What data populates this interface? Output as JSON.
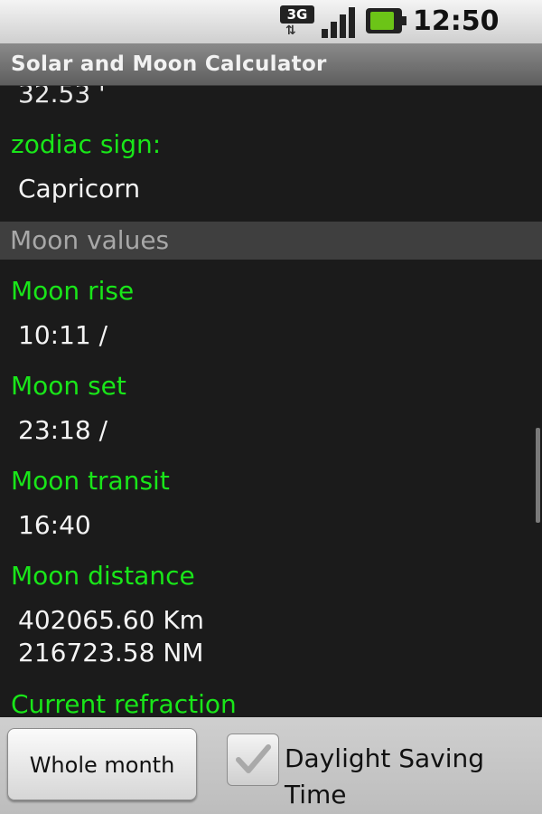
{
  "status_bar": {
    "network": "3G",
    "time": "12:50 PM"
  },
  "app": {
    "title": "Solar and Moon Calculator"
  },
  "content": {
    "partial_value": "32.53 '",
    "zodiac": {
      "label": "zodiac sign:",
      "value": "Capricorn"
    },
    "moon_section": {
      "header": "Moon values",
      "rise_label": "Moon rise",
      "rise_value": "10:11 /",
      "set_label": "Moon set",
      "set_value": "23:18 /",
      "transit_label": "Moon transit",
      "transit_value": "16:40",
      "distance_label": "Moon distance",
      "distance_km": "402065.60  Km",
      "distance_nm": "216723.58  NM",
      "refraction_label": "Current refraction"
    }
  },
  "bottom_bar": {
    "whole_month_label": "Whole month",
    "dst_label": "Daylight Saving Time",
    "dst_checked": true
  },
  "colors": {
    "label_green": "#19e619",
    "background": "#1b1b1b",
    "section_header_bg": "#3f3f3f"
  }
}
